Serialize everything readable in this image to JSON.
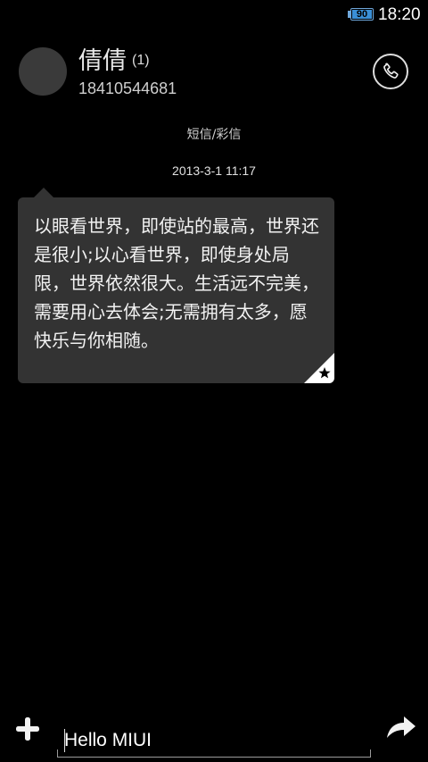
{
  "status_bar": {
    "battery_level": "90",
    "time": "18:20"
  },
  "contact": {
    "name": "倩倩",
    "unread_count": "(1)",
    "number": "18410544681"
  },
  "conversation": {
    "message_type": "短信/彩信",
    "messages": [
      {
        "timestamp": "2013-3-1 11:17",
        "text": "以眼看世界，即使站的最高，世界还是很小;以心看世界，即使身处局限，世界依然很大。生活远不完美，需要用心去体会;无需拥有太多，愿快乐与你相随。",
        "starred": true
      }
    ]
  },
  "composer": {
    "input_value": "Hello MIUI"
  },
  "icons": {
    "call": "phone-icon",
    "add": "plus-icon",
    "send": "send-arrow-icon",
    "star": "star-icon"
  },
  "colors": {
    "background": "#000000",
    "bubble": "#333333",
    "battery_accent": "#3a8fd6"
  }
}
